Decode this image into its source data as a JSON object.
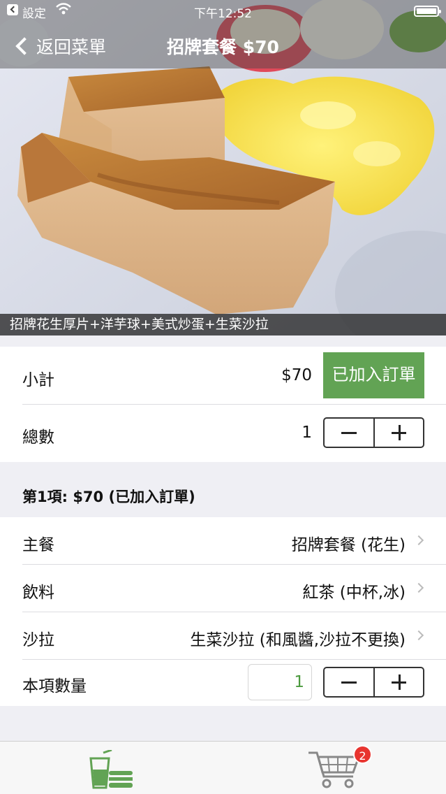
{
  "status_bar": {
    "carrier": "設定",
    "time": "下午12:52"
  },
  "nav": {
    "back_label": "返回菜單",
    "title": "招牌套餐 $70"
  },
  "photo": {
    "caption": "招牌花生厚片+洋芋球+美式炒蛋+生菜沙拉"
  },
  "summary": {
    "subtotal_label": "小計",
    "subtotal_value": "$70",
    "added_button": "已加入訂單",
    "total_label": "總數",
    "total_count": "1"
  },
  "item": {
    "header": "第1項: $70 (已加入訂單)",
    "rows": [
      {
        "label": "主餐",
        "value": "招牌套餐 (花生)"
      },
      {
        "label": "飲料",
        "value": "紅茶 (中杯,冰)"
      },
      {
        "label": "沙拉",
        "value": "生菜沙拉 (和風醬,沙拉不更換)"
      }
    ],
    "quantity_label": "本項數量",
    "quantity_value": "1"
  },
  "tabbar": {
    "cart_badge": "2"
  },
  "colors": {
    "accent_green": "#62a354",
    "badge_red": "#e8342f"
  }
}
